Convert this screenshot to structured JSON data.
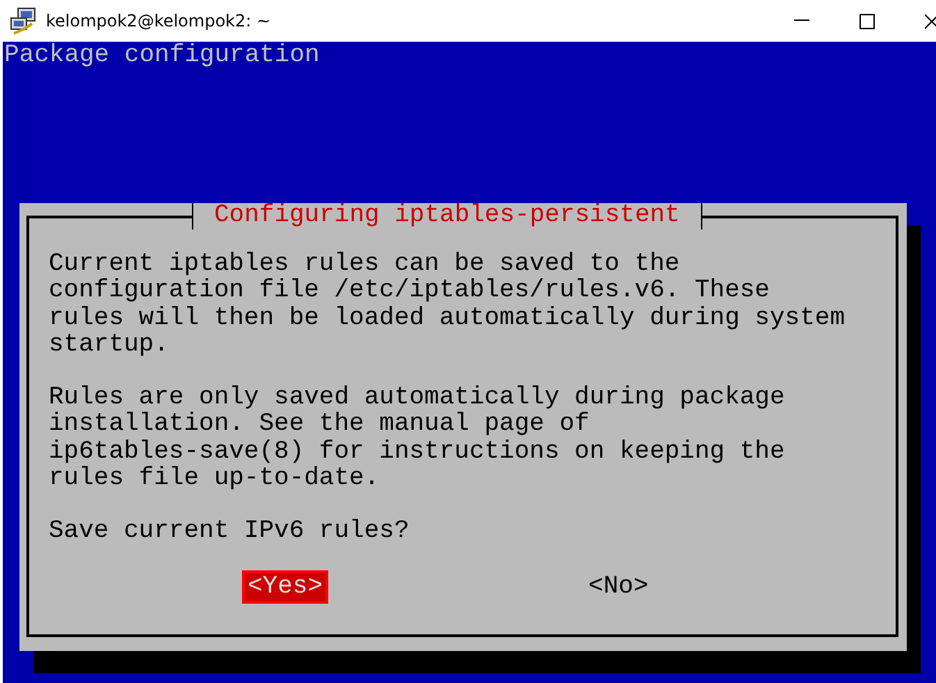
{
  "window": {
    "title": "kelompok2@kelompok2: ~"
  },
  "terminal": {
    "header": "Package configuration"
  },
  "dialog": {
    "title": "Configuring iptables-persistent",
    "paragraphs": [
      "Current iptables rules can be saved to the\nconfiguration file /etc/iptables/rules.v6. These\nrules will then be loaded automatically during system\nstartup.",
      "Rules are only saved automatically during package\ninstallation. See the manual page of\nip6tables-save(8) for instructions on keeping the\nrules file up-to-date."
    ],
    "question": "Save current IPv6 rules?",
    "buttons": [
      {
        "label": "<Yes>",
        "selected": true
      },
      {
        "label": "<No>",
        "selected": false
      }
    ]
  }
}
